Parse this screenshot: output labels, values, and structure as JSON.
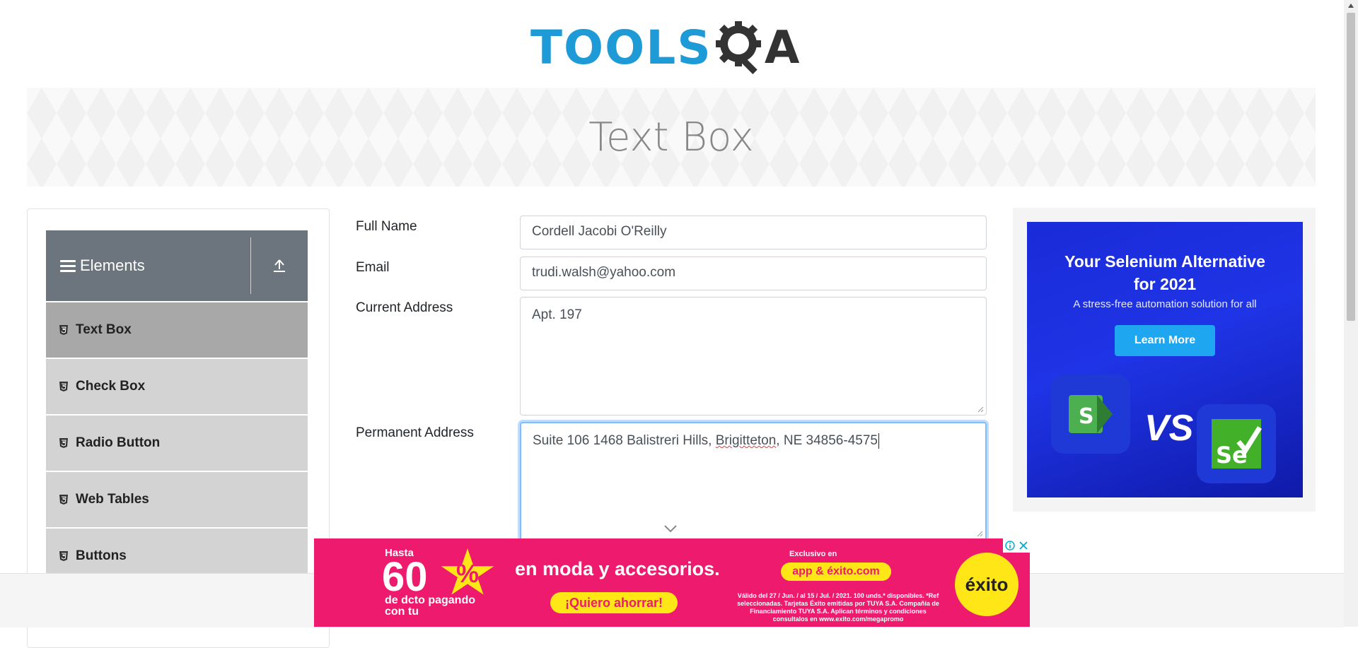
{
  "header": {
    "logo_main": "TOOLS",
    "logo_a": "A"
  },
  "banner": {
    "title": "Text Box"
  },
  "sidebar": {
    "group_title": "Elements",
    "items": [
      {
        "label": "Text Box",
        "active": true
      },
      {
        "label": "Check Box"
      },
      {
        "label": "Radio Button"
      },
      {
        "label": "Web Tables"
      },
      {
        "label": "Buttons"
      }
    ]
  },
  "form": {
    "full_name": {
      "label": "Full Name",
      "value": "Cordell Jacobi O'Reilly"
    },
    "email": {
      "label": "Email",
      "value": "trudi.walsh@yahoo.com"
    },
    "current_address": {
      "label": "Current Address",
      "value": "Apt. 197"
    },
    "permanent_address": {
      "label": "Permanent Address",
      "value_prefix": "Suite 106 1468 Balistreri Hills, ",
      "value_misspelled": "Brigitteton",
      "value_suffix": ", NE 34856-4575"
    }
  },
  "ad_right": {
    "headline_line1": "Your Selenium Alternative",
    "headline_line2": "for 2021",
    "sub": "A stress-free automation solution for all",
    "cta": "Learn More",
    "vs": "VS",
    "logo_right_text": "Se"
  },
  "ad_bottom": {
    "hasta": "Hasta",
    "percent": "60",
    "percent_sign": "%",
    "dcto_line1": "de dcto pagando",
    "dcto_line2": "con tu",
    "tagline": "en moda y accesorios.",
    "cta": "¡Quiero ahorrar!",
    "exclusivo": "Exclusivo en",
    "app": "app & éxito.com",
    "legal": "Válido del 27 / Jun. / al 15 / Jul. / 2021. 100 unds.* disponibles. *Ref seleccionadas. Tarjetas Éxito emitidas por TUYA S.A. Compañía de Financiamiento TUYA S.A. Aplican términos y condiciones consultalos en www.exito.com/megapromo",
    "brand": "éxito"
  },
  "colors": {
    "logo_blue": "#1e9ad6",
    "sidebar_header": "#6c757d",
    "menu_item_bg": "#d3d3d3",
    "menu_item_active": "#a8a8a8",
    "focus_border": "#80bdff",
    "ad_pink": "#ee1a6d",
    "ad_yellow": "#ffe617"
  }
}
